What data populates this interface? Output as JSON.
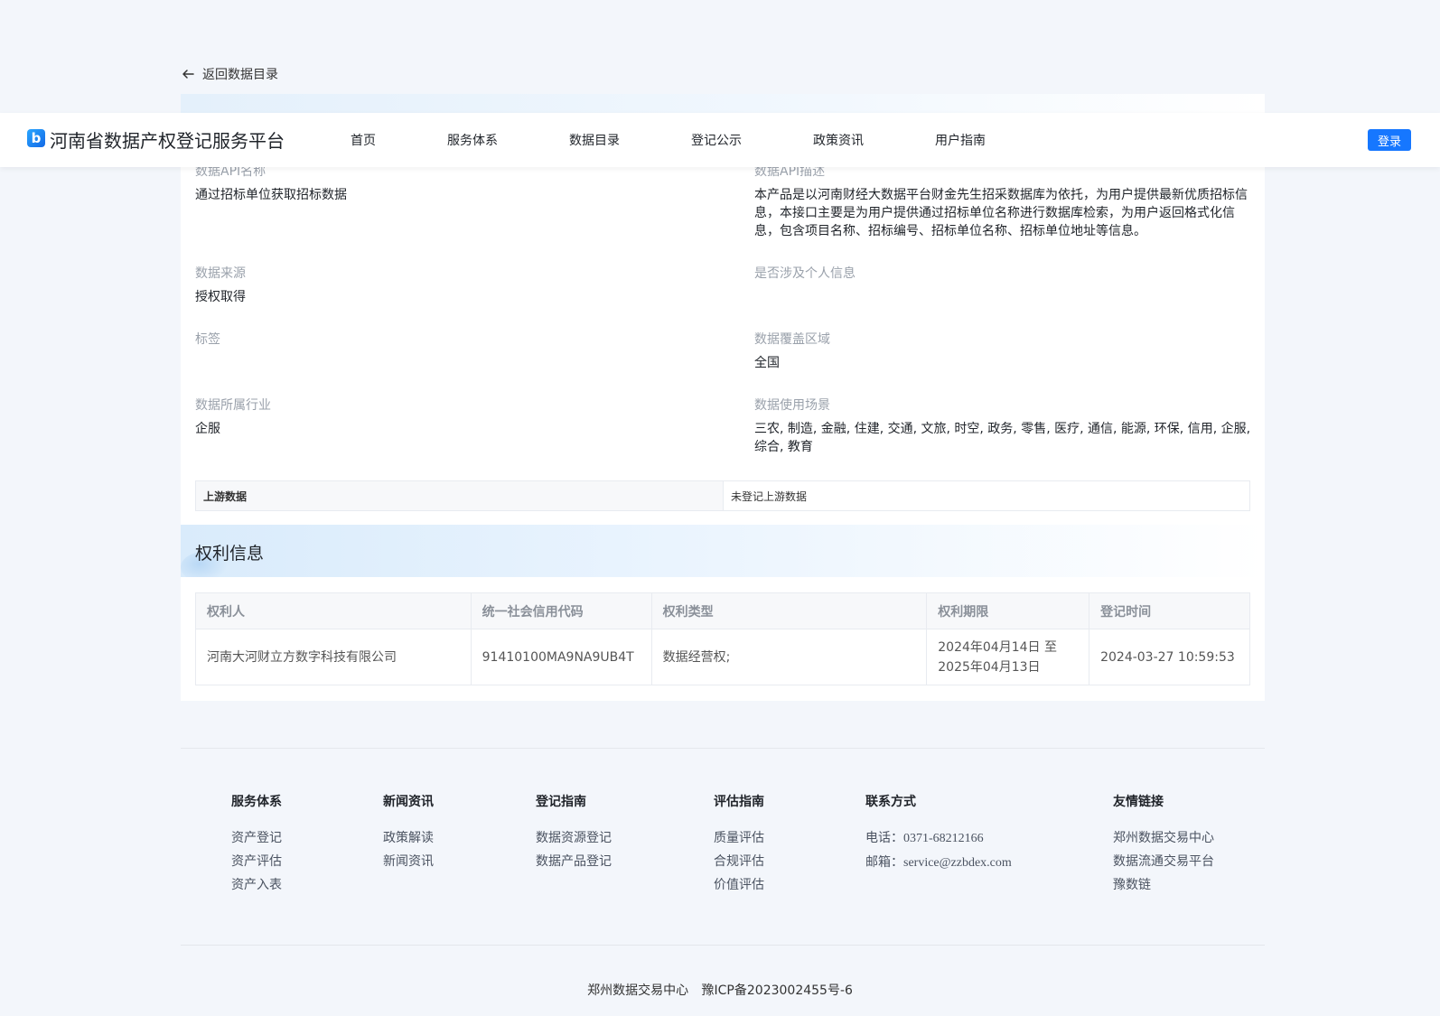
{
  "back": {
    "label": "返回数据目录"
  },
  "header": {
    "logo_glyph": "b",
    "brand": "河南省数据产权登记服务平台",
    "nav": [
      "首页",
      "服务体系",
      "数据目录",
      "登记公示",
      "政策资讯",
      "用户指南"
    ],
    "login": "登录"
  },
  "details": {
    "api_name_label": "数据API名称",
    "api_name_value": "通过招标单位获取招标数据",
    "api_desc_label": "数据API描述",
    "api_desc_value": "本产品是以河南财经大数据平台财金先生招采数据库为依托，为用户提供最新优质招标信息，本接口主要是为用户提供通过招标单位名称进行数据库检索，为用户返回格式化信息，包含项目名称、招标编号、招标单位名称、招标单位地址等信息。",
    "source_label": "数据来源",
    "source_value": "授权取得",
    "personal_label": "是否涉及个人信息",
    "personal_value": "",
    "tags_label": "标签",
    "tags_value": "",
    "coverage_label": "数据覆盖区域",
    "coverage_value": "全国",
    "industry_label": "数据所属行业",
    "industry_value": "企服",
    "scenario_label": "数据使用场景",
    "scenario_value": "三农, 制造, 金融, 住建, 交通, 文旅, 时空, 政务, 零售, 医疗, 通信, 能源, 环保, 信用, 企服, 综合, 教育",
    "upstream_label": "上游数据",
    "upstream_value": "未登记上游数据"
  },
  "rights": {
    "title": "权利信息",
    "columns": [
      "权利人",
      "统一社会信用代码",
      "权利类型",
      "权利期限",
      "登记时间"
    ],
    "rows": [
      {
        "holder": "河南大河财立方数字科技有限公司",
        "credit_code": "91410100MA9NA9UB4T",
        "type": "数据经营权;",
        "period_start": "2024年04月14日 至",
        "period_end": "2025年04月13日",
        "registered": "2024-03-27 10:59:53"
      }
    ]
  },
  "footer": {
    "service": {
      "title": "服务体系",
      "links": [
        "资产登记",
        "资产评估",
        "资产入表"
      ]
    },
    "news": {
      "title": "新闻资讯",
      "links": [
        "政策解读",
        "新闻资讯"
      ]
    },
    "reg_guide": {
      "title": "登记指南",
      "links": [
        "数据资源登记",
        "数据产品登记"
      ]
    },
    "eval_guide": {
      "title": "评估指南",
      "links": [
        "质量评估",
        "合规评估",
        "价值评估"
      ]
    },
    "contact": {
      "title": "联系方式",
      "phone_label": "电话：",
      "phone": "0371-68212166",
      "email_label": "邮箱：",
      "email": "service@zzbdex.com"
    },
    "friends": {
      "title": "友情链接",
      "links": [
        "郑州数据交易中心",
        "数据流通交易平台",
        "豫数链"
      ]
    },
    "copyright_org": "郑州数据交易中心",
    "icp": "豫ICP备2023002455号-6"
  },
  "colors": {
    "accent": "#1677ff",
    "page_bg": "#f3f6fb",
    "label_gray": "#9aa1ab"
  }
}
